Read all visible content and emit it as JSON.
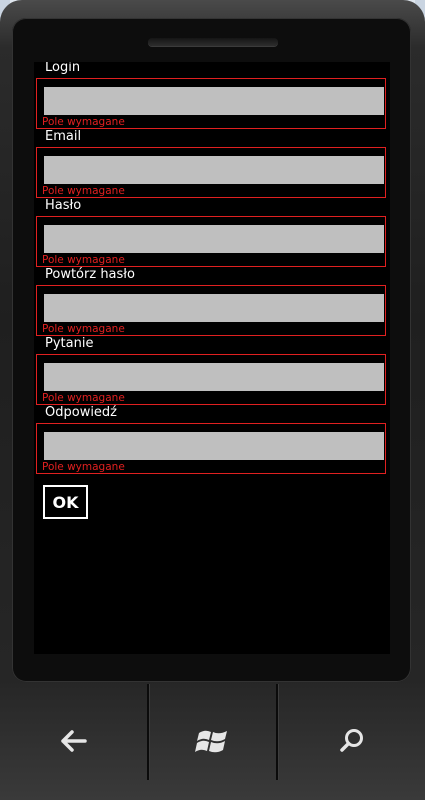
{
  "form": {
    "fields": [
      {
        "label": "Login",
        "value": "",
        "error": "Pole wymagane"
      },
      {
        "label": "Email",
        "value": "",
        "error": "Pole wymagane"
      },
      {
        "label": "Hasło",
        "value": "",
        "error": "Pole wymagane"
      },
      {
        "label": "Powtórz hasło",
        "value": "",
        "error": "Pole wymagane"
      },
      {
        "label": "Pytanie",
        "value": "",
        "error": "Pole wymagane"
      },
      {
        "label": "Odpowiedź",
        "value": "",
        "error": "Pole wymagane"
      }
    ],
    "submit_label": "OK"
  },
  "hardware_buttons": {
    "back": "back-arrow-icon",
    "start": "windows-logo-icon",
    "search": "search-icon"
  },
  "colors": {
    "error": "#e02020",
    "input_bg": "#bfbfbf",
    "screen_bg": "#000000"
  }
}
